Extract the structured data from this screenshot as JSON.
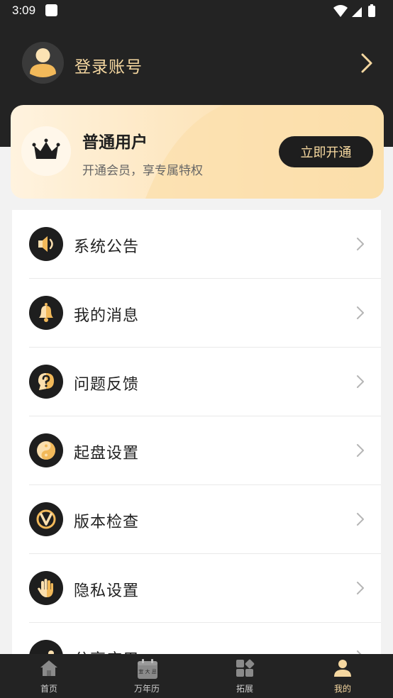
{
  "status_bar": {
    "time": "3:09"
  },
  "account": {
    "login_label": "登录账号"
  },
  "vip": {
    "title": "普通用户",
    "subtitle": "开通会员，享专属特权",
    "button_label": "立即开通"
  },
  "menu": {
    "items": [
      {
        "label": "系统公告",
        "icon": "speaker-icon"
      },
      {
        "label": "我的消息",
        "icon": "bell-icon"
      },
      {
        "label": "问题反馈",
        "icon": "question-icon"
      },
      {
        "label": "起盘设置",
        "icon": "yin-yang-icon"
      },
      {
        "label": "版本检查",
        "icon": "version-icon"
      },
      {
        "label": "隐私设置",
        "icon": "hand-icon"
      },
      {
        "label": "分享应用",
        "icon": "share-icon"
      }
    ]
  },
  "bottom_nav": {
    "items": [
      {
        "label": "首页",
        "icon": "home-icon"
      },
      {
        "label": "万年历",
        "icon": "calendar-icon",
        "icon_text": "宜 大 忌"
      },
      {
        "label": "拓展",
        "icon": "apps-icon"
      },
      {
        "label": "我的",
        "icon": "profile-icon",
        "active": true
      }
    ]
  },
  "colors": {
    "header_bg": "#232323",
    "accent_gold": "#f5d7a0",
    "icon_gold": "#f7c46a",
    "card_gradient_start": "#fff3df",
    "card_gradient_end": "#fbd99c"
  }
}
